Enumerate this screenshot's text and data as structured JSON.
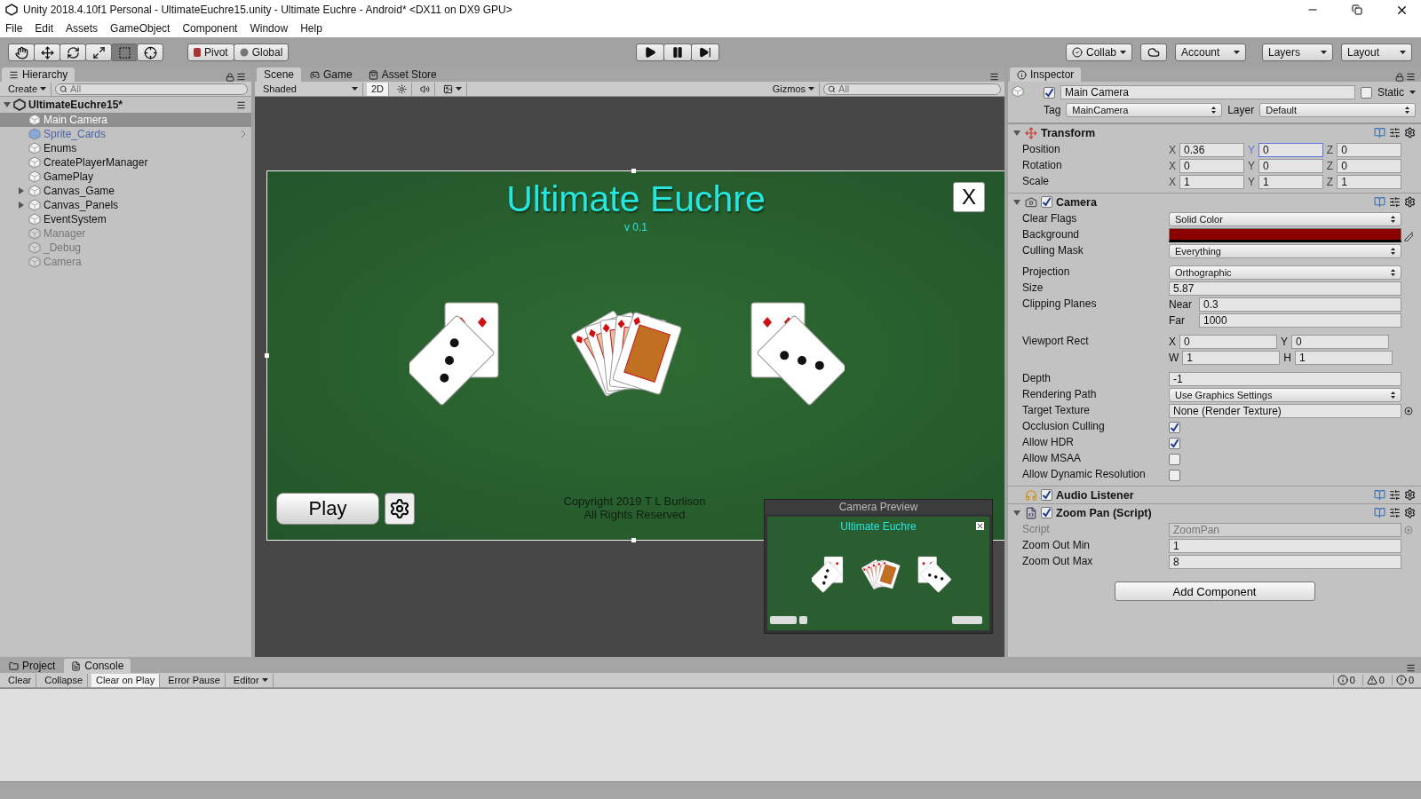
{
  "window": {
    "title": "Unity 2018.4.10f1 Personal - UltimateEuchre15.unity - Ultimate Euchre - Android* <DX11 on DX9 GPU>"
  },
  "menu": [
    "File",
    "Edit",
    "Assets",
    "GameObject",
    "Component",
    "Window",
    "Help"
  ],
  "toolbar": {
    "tools": [
      {
        "kind": "hand",
        "selected": false
      },
      {
        "kind": "move",
        "selected": false
      },
      {
        "kind": "rotate",
        "selected": false
      },
      {
        "kind": "scale",
        "selected": false
      },
      {
        "kind": "rect",
        "selected": true
      },
      {
        "kind": "transform",
        "selected": false
      }
    ],
    "pivot": "Pivot",
    "global": "Global",
    "playback": [
      {
        "kind": "play"
      },
      {
        "kind": "pause"
      },
      {
        "kind": "step"
      }
    ],
    "collab": "Collab",
    "account": "Account",
    "layers": "Layers",
    "layout": "Layout"
  },
  "hierarchy": {
    "tab": "Hierarchy",
    "create": "Create",
    "search_placeholder": "All",
    "scene": "UltimateEuchre15*",
    "items": [
      {
        "name": "Main Camera",
        "selected": true,
        "kind": "object",
        "active": true,
        "expandable": false
      },
      {
        "name": "Sprite_Cards",
        "selected": false,
        "kind": "prefab",
        "active": true,
        "expandable": false
      },
      {
        "name": "Enums",
        "selected": false,
        "kind": "object",
        "active": true,
        "expandable": false
      },
      {
        "name": "CreatePlayerManager",
        "selected": false,
        "kind": "object",
        "active": true,
        "expandable": false
      },
      {
        "name": "GamePlay",
        "selected": false,
        "kind": "object",
        "active": true,
        "expandable": false
      },
      {
        "name": "Canvas_Game",
        "selected": false,
        "kind": "object",
        "active": true,
        "expandable": true
      },
      {
        "name": "Canvas_Panels",
        "selected": false,
        "kind": "object",
        "active": true,
        "expandable": true
      },
      {
        "name": "EventSystem",
        "selected": false,
        "kind": "object",
        "active": true,
        "expandable": false
      },
      {
        "name": "Manager",
        "selected": false,
        "kind": "object",
        "active": false,
        "expandable": false
      },
      {
        "name": "_Debug",
        "selected": false,
        "kind": "object",
        "active": false,
        "expandable": false
      },
      {
        "name": "Camera",
        "selected": false,
        "kind": "object",
        "active": false,
        "expandable": false
      }
    ]
  },
  "scene_view": {
    "tabs": [
      {
        "label": "Scene",
        "kind": "scene",
        "selected": true
      },
      {
        "label": "Game",
        "kind": "game",
        "selected": false
      },
      {
        "label": "Asset Store",
        "kind": "store",
        "selected": false
      }
    ],
    "shading": "Shaded",
    "mode_2d": {
      "label": "2D",
      "on": true
    },
    "lighting": {
      "on": false
    },
    "audio": {
      "on": false
    },
    "gizmos": "Gizmos",
    "search_placeholder": "All"
  },
  "game": {
    "title": "Ultimate Euchre",
    "version": "v 0.1",
    "close": "X",
    "play": "Play",
    "copyright": [
      "Copyright 2019 T L Burlison",
      "All Rights Reserved"
    ]
  },
  "camera_preview": {
    "title": "Camera Preview",
    "game_title": "Ultimate Euchre"
  },
  "inspector": {
    "tab": "Inspector",
    "name": "Main Camera",
    "active": true,
    "static": {
      "label": "Static",
      "checked": false
    },
    "tag_label": "Tag",
    "tag": "MainCamera",
    "layer_label": "Layer",
    "layer": "Default",
    "components": [
      {
        "title": "Transform",
        "kind": "transform",
        "foldable": true,
        "groups": [
          [
            {
              "kind": "vector",
              "label": "Position",
              "fields": [
                {
                  "axis": "X",
                  "value": "0.36",
                  "focused": false
                },
                {
                  "axis": "Y",
                  "value": "0",
                  "focused": true
                },
                {
                  "axis": "Z",
                  "value": "0",
                  "focused": false
                }
              ]
            },
            {
              "kind": "vector",
              "label": "Rotation",
              "fields": [
                {
                  "axis": "X",
                  "value": "0",
                  "focused": false
                },
                {
                  "axis": "Y",
                  "value": "0",
                  "focused": false
                },
                {
                  "axis": "Z",
                  "value": "0",
                  "focused": false
                }
              ]
            },
            {
              "kind": "vector",
              "label": "Scale",
              "fields": [
                {
                  "axis": "X",
                  "value": "1",
                  "focused": false
                },
                {
                  "axis": "Y",
                  "value": "1",
                  "focused": false
                },
                {
                  "axis": "Z",
                  "value": "1",
                  "focused": false
                }
              ]
            }
          ]
        ]
      },
      {
        "title": "Camera",
        "kind": "camera",
        "foldable": true,
        "enabled": true,
        "groups": [
          [
            {
              "kind": "dropdown",
              "label": "Clear Flags",
              "value": "Solid Color"
            },
            {
              "kind": "color",
              "label": "Background",
              "color": "#8b0000"
            },
            {
              "kind": "dropdown",
              "label": "Culling Mask",
              "value": "Everything"
            }
          ],
          [
            {
              "kind": "dropdown",
              "label": "Projection",
              "value": "Orthographic"
            },
            {
              "kind": "field",
              "label": "Size",
              "value": "5.87"
            },
            {
              "kind": "planes",
              "label": "Clipping Planes",
              "fields": [
                {
                  "axis": "Near",
                  "value": "0.3"
                },
                {
                  "axis": "Far",
                  "value": "1000"
                }
              ]
            }
          ],
          [
            {
              "kind": "rect",
              "label": "Viewport Rect",
              "fields": [
                {
                  "axis": "X",
                  "value": "0"
                },
                {
                  "axis": "Y",
                  "value": "0"
                },
                {
                  "axis": "W",
                  "value": "1"
                },
                {
                  "axis": "H",
                  "value": "1"
                }
              ]
            }
          ],
          [
            {
              "kind": "field",
              "label": "Depth",
              "value": "-1"
            },
            {
              "kind": "dropdown",
              "label": "Rendering Path",
              "value": "Use Graphics Settings"
            },
            {
              "kind": "object",
              "label": "Target Texture",
              "value": "None (Render Texture)"
            },
            {
              "kind": "checkbox",
              "label": "Occlusion Culling",
              "checked": true
            },
            {
              "kind": "checkbox",
              "label": "Allow HDR",
              "checked": true
            },
            {
              "kind": "checkbox",
              "label": "Allow MSAA",
              "checked": false
            },
            {
              "kind": "checkbox",
              "label": "Allow Dynamic Resolution",
              "checked": false
            }
          ]
        ]
      },
      {
        "title": "Audio Listener",
        "kind": "audio",
        "foldable": false,
        "enabled": true
      },
      {
        "title": "Zoom Pan (Script)",
        "kind": "script",
        "foldable": true,
        "enabled": true,
        "groups": [
          [
            {
              "kind": "script",
              "label": "Script",
              "value": "ZoomPan"
            },
            {
              "kind": "field",
              "label": "Zoom Out Min",
              "value": "1"
            },
            {
              "kind": "field",
              "label": "Zoom Out Max",
              "value": "8"
            }
          ]
        ]
      }
    ],
    "add_component": "Add Component"
  },
  "console": {
    "tabs": [
      {
        "label": "Project",
        "kind": "folder",
        "selected": false
      },
      {
        "label": "Console",
        "kind": "console",
        "selected": true
      }
    ],
    "buttons": [
      {
        "label": "Clear",
        "kind": "button",
        "on": false
      },
      {
        "label": "Collapse",
        "kind": "toggle",
        "on": false
      },
      {
        "label": "Clear on Play",
        "kind": "toggle",
        "on": true
      },
      {
        "label": "Error Pause",
        "kind": "toggle",
        "on": false
      },
      {
        "label": "Editor",
        "kind": "dropdown",
        "on": false
      }
    ],
    "counts": [
      {
        "kind": "info",
        "value": "0"
      },
      {
        "kind": "warning",
        "value": "0"
      },
      {
        "kind": "error",
        "value": "0"
      }
    ]
  }
}
